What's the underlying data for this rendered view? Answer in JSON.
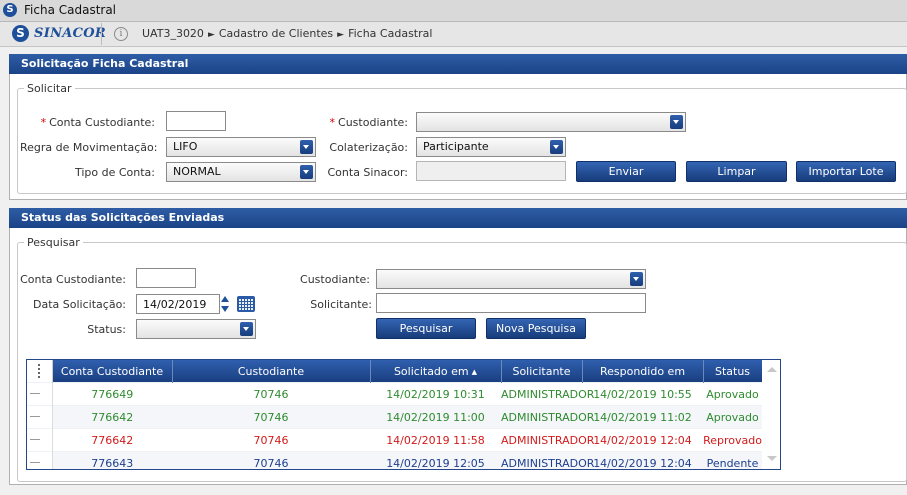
{
  "window": {
    "title": "Ficha Cadastral"
  },
  "brand": {
    "logo_letter": "S",
    "logo_text": "SINACOR"
  },
  "navbar": {
    "breadcrumb": [
      "UAT3_3020",
      "Cadastro de Clientes",
      "Ficha Cadastral"
    ],
    "breadcrumb_separator": "►"
  },
  "request_panel": {
    "title": "Solicitação Ficha Cadastral",
    "group_label": "Solicitar",
    "required_marker": "*",
    "fields": {
      "conta_custodiante": {
        "label": "Conta Custodiante:",
        "value": ""
      },
      "custodiante": {
        "label": "Custodiante:",
        "value": ""
      },
      "regra_movimentacao": {
        "label": "Regra de Movimentação:",
        "value": "LIFO"
      },
      "colateralizacao": {
        "label": "Colaterização:",
        "value": "Participante"
      },
      "tipo_conta": {
        "label": "Tipo de Conta:",
        "value": "NORMAL"
      },
      "conta_sinacor": {
        "label": "Conta Sinacor:",
        "value": ""
      }
    },
    "buttons": {
      "enviar": "Enviar",
      "limpar": "Limpar",
      "importar": "Importar Lote"
    }
  },
  "status_panel": {
    "title": "Status das Solicitações Enviadas",
    "group_label": "Pesquisar",
    "fields": {
      "conta_custodiante": {
        "label": "Conta Custodiante:",
        "value": ""
      },
      "custodiante": {
        "label": "Custodiante:",
        "value": ""
      },
      "data_solicitacao": {
        "label": "Data Solicitação:",
        "value": "14/02/2019"
      },
      "solicitante": {
        "label": "Solicitante:",
        "value": ""
      },
      "status": {
        "label": "Status:",
        "value": ""
      }
    },
    "buttons": {
      "pesquisar": "Pesquisar",
      "nova_pesquisa": "Nova Pesquisa"
    }
  },
  "grid": {
    "columns": [
      "Conta Custodiante",
      "Custodiante",
      "Solicitado em",
      "Solicitante",
      "Respondido em",
      "Status"
    ],
    "sort_indicator": "▲",
    "rows": [
      {
        "conta": "776649",
        "custodiante": "70746",
        "solicitado": "14/02/2019 10:31",
        "solicitante": "ADMINISTRADOR",
        "respondido": "14/02/2019 10:55",
        "status": "Aprovado",
        "color": "#2e8b2e"
      },
      {
        "conta": "776642",
        "custodiante": "70746",
        "solicitado": "14/02/2019 11:00",
        "solicitante": "ADMINISTRADOR",
        "respondido": "14/02/2019 11:02",
        "status": "Aprovado",
        "color": "#2e8b2e"
      },
      {
        "conta": "776642",
        "custodiante": "70746",
        "solicitado": "14/02/2019 11:58",
        "solicitante": "ADMINISTRADOR",
        "respondido": "14/02/2019 12:04",
        "status": "Reprovado",
        "color": "#d21b1b"
      },
      {
        "conta": "776643",
        "custodiante": "70746",
        "solicitado": "14/02/2019 12:05",
        "solicitante": "ADMINISTRADOR",
        "respondido": "14/02/2019 12:04",
        "status": "Pendente",
        "color": "#1d3f8f"
      }
    ]
  },
  "colors": {
    "header_blue": "#1b4387",
    "approved": "#2e8b2e",
    "rejected": "#d21b1b",
    "pending": "#1d3f8f"
  }
}
